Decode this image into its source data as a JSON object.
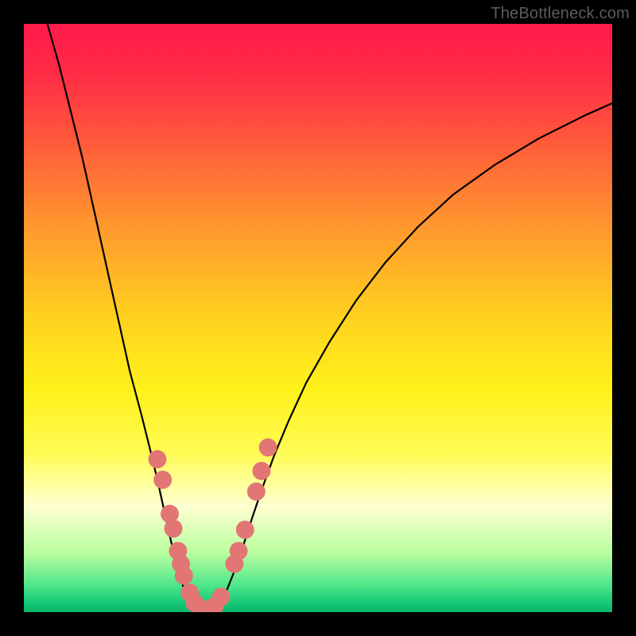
{
  "watermark": "TheBottleneck.com",
  "chart_data": {
    "type": "line",
    "title": "",
    "xlabel": "",
    "ylabel": "",
    "xlim": [
      0,
      1
    ],
    "ylim": [
      0,
      1
    ],
    "background_gradient": {
      "stops": [
        {
          "offset": 0.0,
          "color": "#ff1a4b"
        },
        {
          "offset": 0.08,
          "color": "#ff2a46"
        },
        {
          "offset": 0.2,
          "color": "#ff5a3a"
        },
        {
          "offset": 0.35,
          "color": "#ff9a2d"
        },
        {
          "offset": 0.5,
          "color": "#ffd21f"
        },
        {
          "offset": 0.62,
          "color": "#fff11a"
        },
        {
          "offset": 0.73,
          "color": "#fffb55"
        },
        {
          "offset": 0.78,
          "color": "#ffff9a"
        },
        {
          "offset": 0.82,
          "color": "#fdffd0"
        },
        {
          "offset": 0.9,
          "color": "#b9ff9f"
        },
        {
          "offset": 0.955,
          "color": "#4de68a"
        },
        {
          "offset": 0.985,
          "color": "#14c877"
        },
        {
          "offset": 1.0,
          "color": "#0ab46a"
        }
      ]
    },
    "series": [
      {
        "name": "bottleneck-curve",
        "stroke": "#000000",
        "stroke_width": 2.2,
        "points": [
          {
            "x": 0.04,
            "y": 1.0
          },
          {
            "x": 0.06,
            "y": 0.93
          },
          {
            "x": 0.08,
            "y": 0.85
          },
          {
            "x": 0.1,
            "y": 0.77
          },
          {
            "x": 0.12,
            "y": 0.68
          },
          {
            "x": 0.14,
            "y": 0.59
          },
          {
            "x": 0.16,
            "y": 0.5
          },
          {
            "x": 0.18,
            "y": 0.41
          },
          {
            "x": 0.2,
            "y": 0.335
          },
          {
            "x": 0.215,
            "y": 0.275
          },
          {
            "x": 0.227,
            "y": 0.225
          },
          {
            "x": 0.238,
            "y": 0.175
          },
          {
            "x": 0.248,
            "y": 0.13
          },
          {
            "x": 0.256,
            "y": 0.095
          },
          {
            "x": 0.264,
            "y": 0.065
          },
          {
            "x": 0.272,
            "y": 0.04
          },
          {
            "x": 0.281,
            "y": 0.022
          },
          {
            "x": 0.29,
            "y": 0.01
          },
          {
            "x": 0.3,
            "y": 0.004
          },
          {
            "x": 0.312,
            "y": 0.003
          },
          {
            "x": 0.323,
            "y": 0.008
          },
          {
            "x": 0.334,
            "y": 0.02
          },
          {
            "x": 0.346,
            "y": 0.04
          },
          {
            "x": 0.358,
            "y": 0.07
          },
          {
            "x": 0.372,
            "y": 0.11
          },
          {
            "x": 0.388,
            "y": 0.16
          },
          {
            "x": 0.405,
            "y": 0.21
          },
          {
            "x": 0.425,
            "y": 0.265
          },
          {
            "x": 0.45,
            "y": 0.325
          },
          {
            "x": 0.48,
            "y": 0.39
          },
          {
            "x": 0.52,
            "y": 0.46
          },
          {
            "x": 0.565,
            "y": 0.53
          },
          {
            "x": 0.615,
            "y": 0.595
          },
          {
            "x": 0.67,
            "y": 0.655
          },
          {
            "x": 0.73,
            "y": 0.71
          },
          {
            "x": 0.8,
            "y": 0.76
          },
          {
            "x": 0.875,
            "y": 0.805
          },
          {
            "x": 0.955,
            "y": 0.845
          },
          {
            "x": 1.0,
            "y": 0.865
          }
        ]
      }
    ],
    "markers": {
      "fill": "#e27674",
      "radius_norm": 0.0155,
      "points": [
        {
          "x": 0.227,
          "y": 0.26
        },
        {
          "x": 0.236,
          "y": 0.225
        },
        {
          "x": 0.248,
          "y": 0.167
        },
        {
          "x": 0.254,
          "y": 0.142
        },
        {
          "x": 0.262,
          "y": 0.104
        },
        {
          "x": 0.267,
          "y": 0.082
        },
        {
          "x": 0.272,
          "y": 0.062
        },
        {
          "x": 0.282,
          "y": 0.033
        },
        {
          "x": 0.29,
          "y": 0.016
        },
        {
          "x": 0.3,
          "y": 0.007
        },
        {
          "x": 0.312,
          "y": 0.004
        },
        {
          "x": 0.324,
          "y": 0.01
        },
        {
          "x": 0.335,
          "y": 0.026
        },
        {
          "x": 0.358,
          "y": 0.082
        },
        {
          "x": 0.365,
          "y": 0.104
        },
        {
          "x": 0.376,
          "y": 0.14
        },
        {
          "x": 0.395,
          "y": 0.205
        },
        {
          "x": 0.404,
          "y": 0.24
        },
        {
          "x": 0.415,
          "y": 0.28
        }
      ]
    }
  }
}
